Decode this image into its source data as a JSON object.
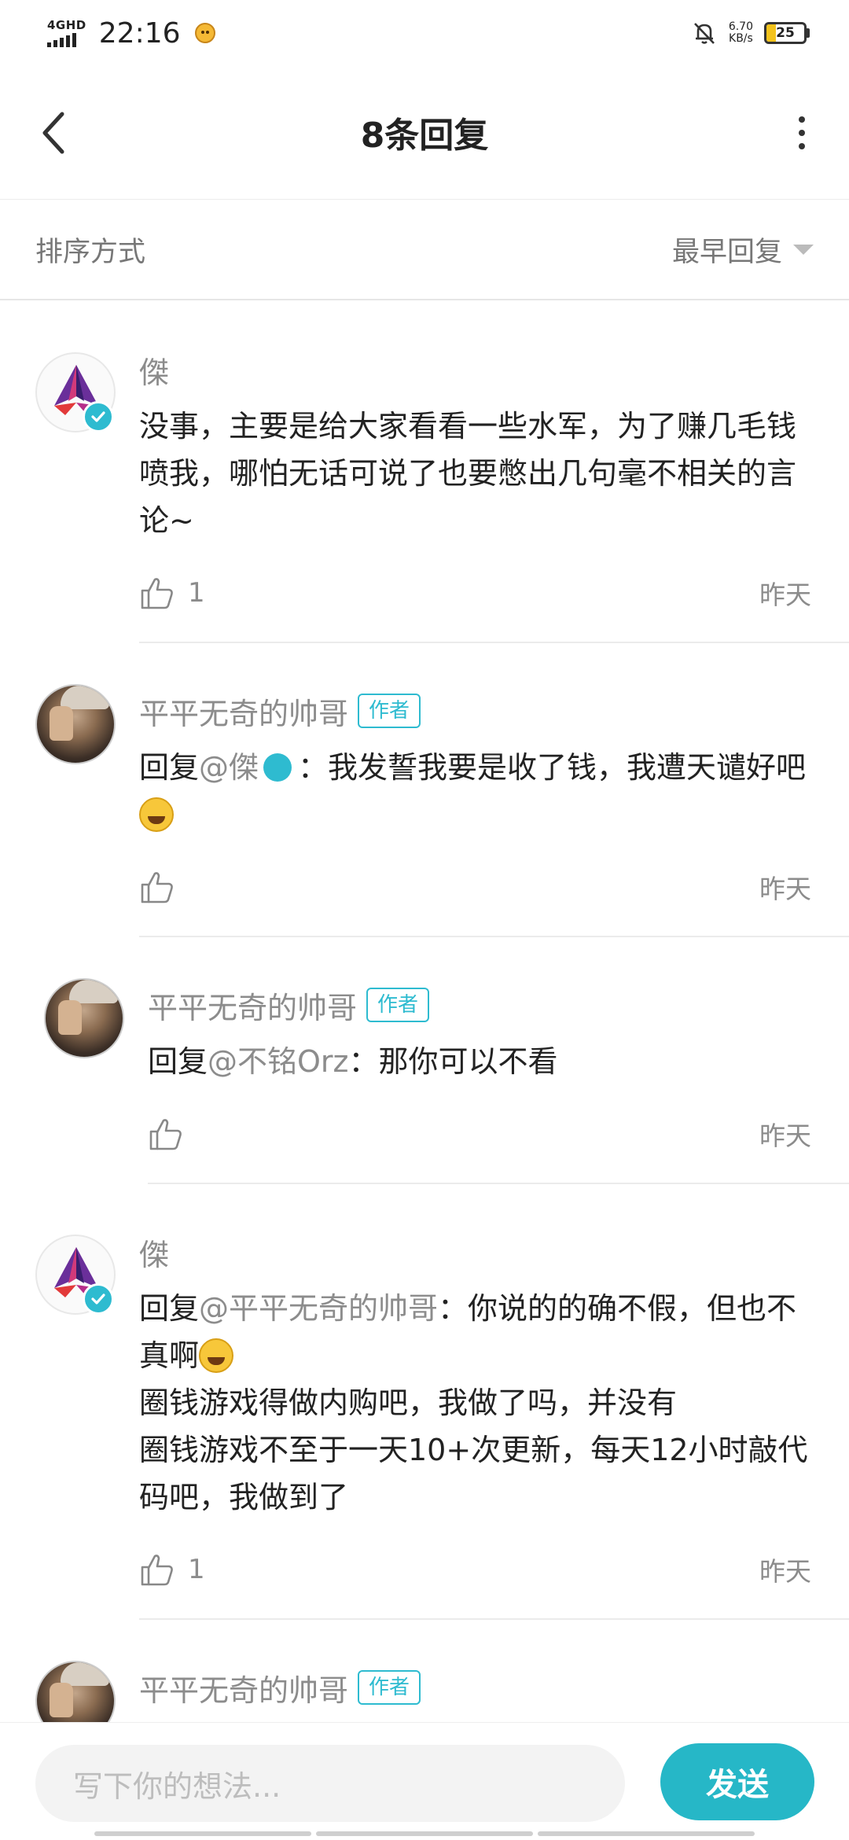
{
  "status_bar": {
    "network": "4GHD",
    "time": "22:16",
    "speed_value": "6.70",
    "speed_unit": "KB/s",
    "battery": "25",
    "battery_level": 0.25,
    "battery_color": "#f3c31c"
  },
  "header": {
    "title": "8条回复"
  },
  "sort": {
    "label": "排序方式",
    "selected": "最早回复"
  },
  "comments": [
    {
      "user": "傑",
      "author_tag": "",
      "text": "没事，主要是给大家看看一些水军，为了赚几毛钱喷我，哪怕无话可说了也要憋出几句毫不相关的言论~",
      "likes": "1",
      "time": "昨天"
    },
    {
      "user": "平平无奇的帅哥",
      "author_tag": "作者",
      "reply_prefix": "回复",
      "mention": "@傑",
      "text": "：我发誓我要是收了钱，我遭天谴好吧",
      "likes": "",
      "time": "昨天"
    },
    {
      "user": "平平无奇的帅哥",
      "author_tag": "作者",
      "reply_prefix": "回复",
      "mention": "@不铭Orz",
      "text": "：那你可以不看",
      "likes": "",
      "time": "昨天"
    },
    {
      "user": "傑",
      "author_tag": "",
      "reply_prefix": "回复",
      "mention": "@平平无奇的帅哥",
      "text_line1": "：你说的的确不假，但也不真啊",
      "text_line2": "圈钱游戏得做内购吧，我做了吗，并没有",
      "text_line3": "圈钱游戏不至于一天10+次更新，每天12小时敲代码吧，我做到了",
      "likes": "1",
      "time": "昨天"
    },
    {
      "user": "平平无奇的帅哥",
      "author_tag": "作者"
    }
  ],
  "input_bar": {
    "placeholder": "写下你的想法...",
    "send_label": "发送"
  },
  "colors": {
    "accent": "#26b7c7",
    "badge": "#2ebbd0"
  }
}
